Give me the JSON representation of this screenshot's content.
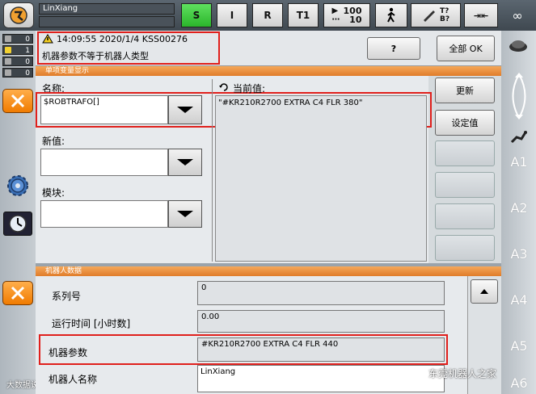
{
  "topbar": {
    "robot_name": "LinXiang",
    "mode_buttons": [
      "S",
      "I",
      "R",
      "T1"
    ],
    "speed_top": "100",
    "speed_bottom": "10",
    "tool_label_top": "T?",
    "tool_label_bottom": "B?",
    "infinity": "∞"
  },
  "message_counters": [
    "0",
    "1",
    "0",
    "0"
  ],
  "message": {
    "header": "14:09:55 2020/1/4 KSS00276",
    "text": "机器参数不等于机器人类型",
    "help_label": "?",
    "ack_all_label": "全部 OK"
  },
  "single_var": {
    "section_title": "单项变量显示",
    "name_label": "名称:",
    "name_value": "$ROBTRAFO[]",
    "current_label": "当前值:",
    "current_value": "\"#KR210R2700 EXTRA C4 FLR 380\"",
    "new_value_label": "新值:",
    "module_label": "模块:",
    "update_label": "更新",
    "set_label": "设定值"
  },
  "robot_data": {
    "section_title": "机器人数据",
    "rows": [
      {
        "label": "系列号",
        "value": "0"
      },
      {
        "label": "运行时间 [小时数]",
        "value": "0.00"
      },
      {
        "label": "机器参数",
        "value": "#KR210R2700 EXTRA C4 FLR 440"
      },
      {
        "label": "机器人名称",
        "value": "LinXiang"
      }
    ]
  },
  "axes": [
    "A1",
    "A2",
    "A3",
    "A4",
    "A5",
    "A6"
  ],
  "watermark": "东莞机器人之家",
  "watermark_left": "大数据说"
}
